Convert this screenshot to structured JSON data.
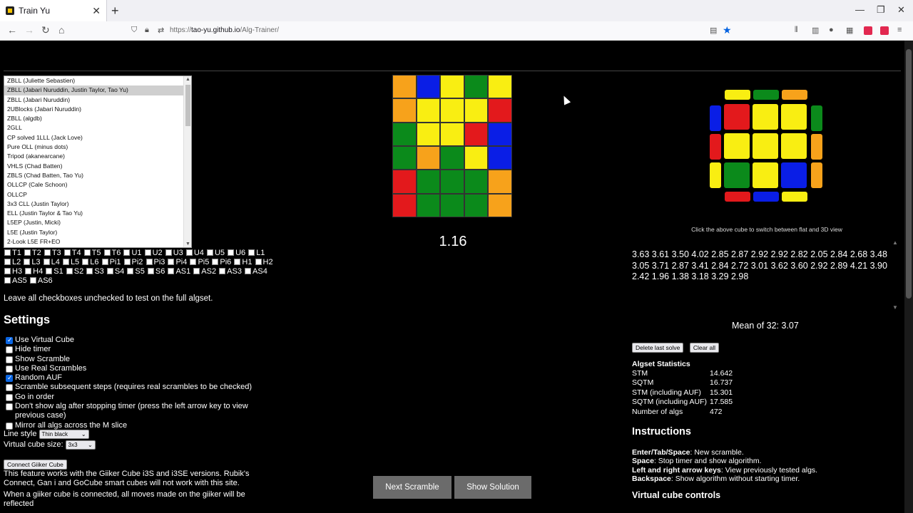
{
  "browser": {
    "tab_title": "Train Yu",
    "url_prefix": "https://",
    "url_host": "tao-yu.github.io",
    "url_path": "/Alg-Trainer/",
    "new_tab": "+",
    "tab_close": "✕"
  },
  "alg_list": [
    "ZBLL (Juliette Sebastien)",
    "ZBLL (Jabari Nuruddin, Justin Taylor, Tao Yu)",
    "ZBLL (Jabari Nuruddin)",
    "2UBlocks (Jabari Nuruddin)",
    "ZBLL (algdb)",
    "2GLL",
    "CP solved 1LLL (Jack Love)",
    "Pure OLL (minus dots)",
    "Tripod (akanearcane)",
    "VHLS (Chad Batten)",
    "ZBLS (Chad Batten, Tao Yu)",
    "OLLCP (Cale Schoon)",
    "OLLCP",
    "3x3 CLL (Justin Taylor)",
    "ELL (Justin Taylor & Tao Yu)",
    "L5EP (Justin, Micki)",
    "L5E (Justin Taylor)",
    "2-Look L5E FR+EO"
  ],
  "alg_selected_index": 1,
  "cases": [
    "T1",
    "T2",
    "T3",
    "T4",
    "T5",
    "T6",
    "U1",
    "U2",
    "U3",
    "U4",
    "U5",
    "U6",
    "L1",
    "L2",
    "L3",
    "L4",
    "L5",
    "L6",
    "Pi1",
    "Pi2",
    "Pi3",
    "Pi4",
    "Pi5",
    "Pi6",
    "H1",
    "H2",
    "H3",
    "H4",
    "S1",
    "S2",
    "S3",
    "S4",
    "S5",
    "S6",
    "AS1",
    "AS2",
    "AS3",
    "AS4",
    "AS5",
    "AS6"
  ],
  "note": "Leave all checkboxes unchecked to test on the full algset.",
  "settings": {
    "heading": "Settings",
    "options": [
      {
        "label": "Use Virtual Cube",
        "checked": true
      },
      {
        "label": "Hide timer",
        "checked": false
      },
      {
        "label": "Show Scramble",
        "checked": false
      },
      {
        "label": "Use Real Scrambles",
        "checked": false
      },
      {
        "label": "Random AUF",
        "checked": true
      },
      {
        "label": "Scramble subsequent steps (requires real scrambles to be checked)",
        "checked": false
      },
      {
        "label": "Go in order",
        "checked": false
      },
      {
        "label": "Don't show alg after stopping timer (press the left arrow key to view previous case)",
        "checked": false
      },
      {
        "label": "Mirror all algs across the M slice",
        "checked": false
      }
    ],
    "line_style_label": "Line style",
    "line_style_value": "Thin black",
    "cube_size_label": "Virtual cube size:",
    "cube_size_value": "3x3",
    "giiker_button": "Connect Giiker Cube",
    "giiker_note": "This feature works with the Giiker Cube i3S and i3SE versions. Rubik's Connect, Gan i and GoCube smart cubes will not work with this site.",
    "giiker_note2": "When a giiker cube is connected, all moves made on the giiker will be reflected"
  },
  "flat_cube": {
    "colors": {
      "O": "#f7a21b",
      "B": "#0a1ee6",
      "Y": "#f9ee12",
      "G": "#0b8a1b",
      "R": "#e3191c"
    },
    "grid": [
      [
        "O",
        "B",
        "Y",
        "G",
        "Y"
      ],
      [
        "O",
        "Y",
        "Y",
        "Y",
        "R"
      ],
      [
        "G",
        "Y",
        "Y",
        "R",
        "B"
      ],
      [
        "G",
        "O",
        "G",
        "Y",
        "B"
      ],
      [
        "R",
        "G",
        "G",
        "G",
        "O"
      ],
      [
        "R",
        "G",
        "G",
        "G",
        "O"
      ]
    ]
  },
  "timer_value": "1.16",
  "buttons": {
    "next": "Next Scramble",
    "solution": "Show Solution"
  },
  "cube3d_hint": "Click the above cube to switch between flat and 3D view",
  "cube3d": {
    "top": [
      "Y",
      "G",
      "O"
    ],
    "left": [
      "B",
      "R",
      "Y"
    ],
    "right": [
      "G",
      "O",
      "O"
    ],
    "bottom": [
      "R",
      "B",
      "Y"
    ],
    "face": [
      [
        "R",
        "Y",
        "Y"
      ],
      [
        "Y",
        "Y",
        "Y"
      ],
      [
        "G",
        "Y",
        "B"
      ]
    ]
  },
  "times": "3.63 3.61 3.50 4.02 2.85 2.87 2.92 2.92 2.82 2.05 2.84 2.68 3.48 3.05 3.71 2.87 3.41 2.84 2.72 3.01 3.62 3.60 2.92 2.89 4.21 3.90 2.42 1.96 1.38 3.18 3.29 2.98",
  "mean": "Mean of 32: 3.07",
  "delete_last": "Delete last solve",
  "clear_all": "Clear all",
  "stats": {
    "heading": "Algset Statistics",
    "rows": [
      {
        "k": "STM",
        "v": "14.642"
      },
      {
        "k": "SQTM",
        "v": "16.737"
      },
      {
        "k": "STM (including AUF)",
        "v": "15.301"
      },
      {
        "k": "SQTM (including AUF)",
        "v": "17.585"
      },
      {
        "k": "Number of algs",
        "v": "472"
      }
    ]
  },
  "instructions": {
    "heading": "Instructions",
    "rows": [
      {
        "k": "Enter/Tab/Space",
        "v": ": New scramble."
      },
      {
        "k": "Space",
        "v": ": Stop timer and show algorithm."
      },
      {
        "k": "Left and right arrow keys",
        "v": ": View previously tested algs."
      },
      {
        "k": "Backspace",
        "v": ": Show algorithm without starting timer."
      }
    ],
    "next_heading": "Virtual cube controls"
  }
}
